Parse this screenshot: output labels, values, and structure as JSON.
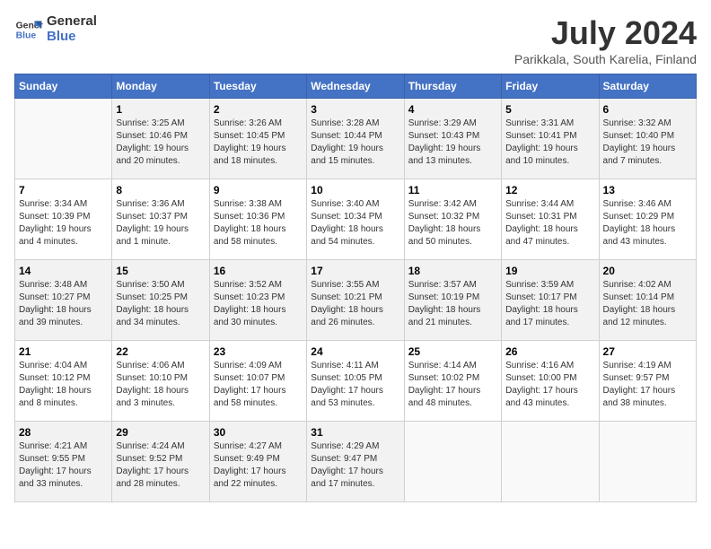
{
  "header": {
    "logo_line1": "General",
    "logo_line2": "Blue",
    "month_year": "July 2024",
    "location": "Parikkala, South Karelia, Finland"
  },
  "weekdays": [
    "Sunday",
    "Monday",
    "Tuesday",
    "Wednesday",
    "Thursday",
    "Friday",
    "Saturday"
  ],
  "weeks": [
    [
      {
        "day": "",
        "info": ""
      },
      {
        "day": "1",
        "info": "Sunrise: 3:25 AM\nSunset: 10:46 PM\nDaylight: 19 hours\nand 20 minutes."
      },
      {
        "day": "2",
        "info": "Sunrise: 3:26 AM\nSunset: 10:45 PM\nDaylight: 19 hours\nand 18 minutes."
      },
      {
        "day": "3",
        "info": "Sunrise: 3:28 AM\nSunset: 10:44 PM\nDaylight: 19 hours\nand 15 minutes."
      },
      {
        "day": "4",
        "info": "Sunrise: 3:29 AM\nSunset: 10:43 PM\nDaylight: 19 hours\nand 13 minutes."
      },
      {
        "day": "5",
        "info": "Sunrise: 3:31 AM\nSunset: 10:41 PM\nDaylight: 19 hours\nand 10 minutes."
      },
      {
        "day": "6",
        "info": "Sunrise: 3:32 AM\nSunset: 10:40 PM\nDaylight: 19 hours\nand 7 minutes."
      }
    ],
    [
      {
        "day": "7",
        "info": "Sunrise: 3:34 AM\nSunset: 10:39 PM\nDaylight: 19 hours\nand 4 minutes."
      },
      {
        "day": "8",
        "info": "Sunrise: 3:36 AM\nSunset: 10:37 PM\nDaylight: 19 hours\nand 1 minute."
      },
      {
        "day": "9",
        "info": "Sunrise: 3:38 AM\nSunset: 10:36 PM\nDaylight: 18 hours\nand 58 minutes."
      },
      {
        "day": "10",
        "info": "Sunrise: 3:40 AM\nSunset: 10:34 PM\nDaylight: 18 hours\nand 54 minutes."
      },
      {
        "day": "11",
        "info": "Sunrise: 3:42 AM\nSunset: 10:32 PM\nDaylight: 18 hours\nand 50 minutes."
      },
      {
        "day": "12",
        "info": "Sunrise: 3:44 AM\nSunset: 10:31 PM\nDaylight: 18 hours\nand 47 minutes."
      },
      {
        "day": "13",
        "info": "Sunrise: 3:46 AM\nSunset: 10:29 PM\nDaylight: 18 hours\nand 43 minutes."
      }
    ],
    [
      {
        "day": "14",
        "info": "Sunrise: 3:48 AM\nSunset: 10:27 PM\nDaylight: 18 hours\nand 39 minutes."
      },
      {
        "day": "15",
        "info": "Sunrise: 3:50 AM\nSunset: 10:25 PM\nDaylight: 18 hours\nand 34 minutes."
      },
      {
        "day": "16",
        "info": "Sunrise: 3:52 AM\nSunset: 10:23 PM\nDaylight: 18 hours\nand 30 minutes."
      },
      {
        "day": "17",
        "info": "Sunrise: 3:55 AM\nSunset: 10:21 PM\nDaylight: 18 hours\nand 26 minutes."
      },
      {
        "day": "18",
        "info": "Sunrise: 3:57 AM\nSunset: 10:19 PM\nDaylight: 18 hours\nand 21 minutes."
      },
      {
        "day": "19",
        "info": "Sunrise: 3:59 AM\nSunset: 10:17 PM\nDaylight: 18 hours\nand 17 minutes."
      },
      {
        "day": "20",
        "info": "Sunrise: 4:02 AM\nSunset: 10:14 PM\nDaylight: 18 hours\nand 12 minutes."
      }
    ],
    [
      {
        "day": "21",
        "info": "Sunrise: 4:04 AM\nSunset: 10:12 PM\nDaylight: 18 hours\nand 8 minutes."
      },
      {
        "day": "22",
        "info": "Sunrise: 4:06 AM\nSunset: 10:10 PM\nDaylight: 18 hours\nand 3 minutes."
      },
      {
        "day": "23",
        "info": "Sunrise: 4:09 AM\nSunset: 10:07 PM\nDaylight: 17 hours\nand 58 minutes."
      },
      {
        "day": "24",
        "info": "Sunrise: 4:11 AM\nSunset: 10:05 PM\nDaylight: 17 hours\nand 53 minutes."
      },
      {
        "day": "25",
        "info": "Sunrise: 4:14 AM\nSunset: 10:02 PM\nDaylight: 17 hours\nand 48 minutes."
      },
      {
        "day": "26",
        "info": "Sunrise: 4:16 AM\nSunset: 10:00 PM\nDaylight: 17 hours\nand 43 minutes."
      },
      {
        "day": "27",
        "info": "Sunrise: 4:19 AM\nSunset: 9:57 PM\nDaylight: 17 hours\nand 38 minutes."
      }
    ],
    [
      {
        "day": "28",
        "info": "Sunrise: 4:21 AM\nSunset: 9:55 PM\nDaylight: 17 hours\nand 33 minutes."
      },
      {
        "day": "29",
        "info": "Sunrise: 4:24 AM\nSunset: 9:52 PM\nDaylight: 17 hours\nand 28 minutes."
      },
      {
        "day": "30",
        "info": "Sunrise: 4:27 AM\nSunset: 9:49 PM\nDaylight: 17 hours\nand 22 minutes."
      },
      {
        "day": "31",
        "info": "Sunrise: 4:29 AM\nSunset: 9:47 PM\nDaylight: 17 hours\nand 17 minutes."
      },
      {
        "day": "",
        "info": ""
      },
      {
        "day": "",
        "info": ""
      },
      {
        "day": "",
        "info": ""
      }
    ]
  ]
}
